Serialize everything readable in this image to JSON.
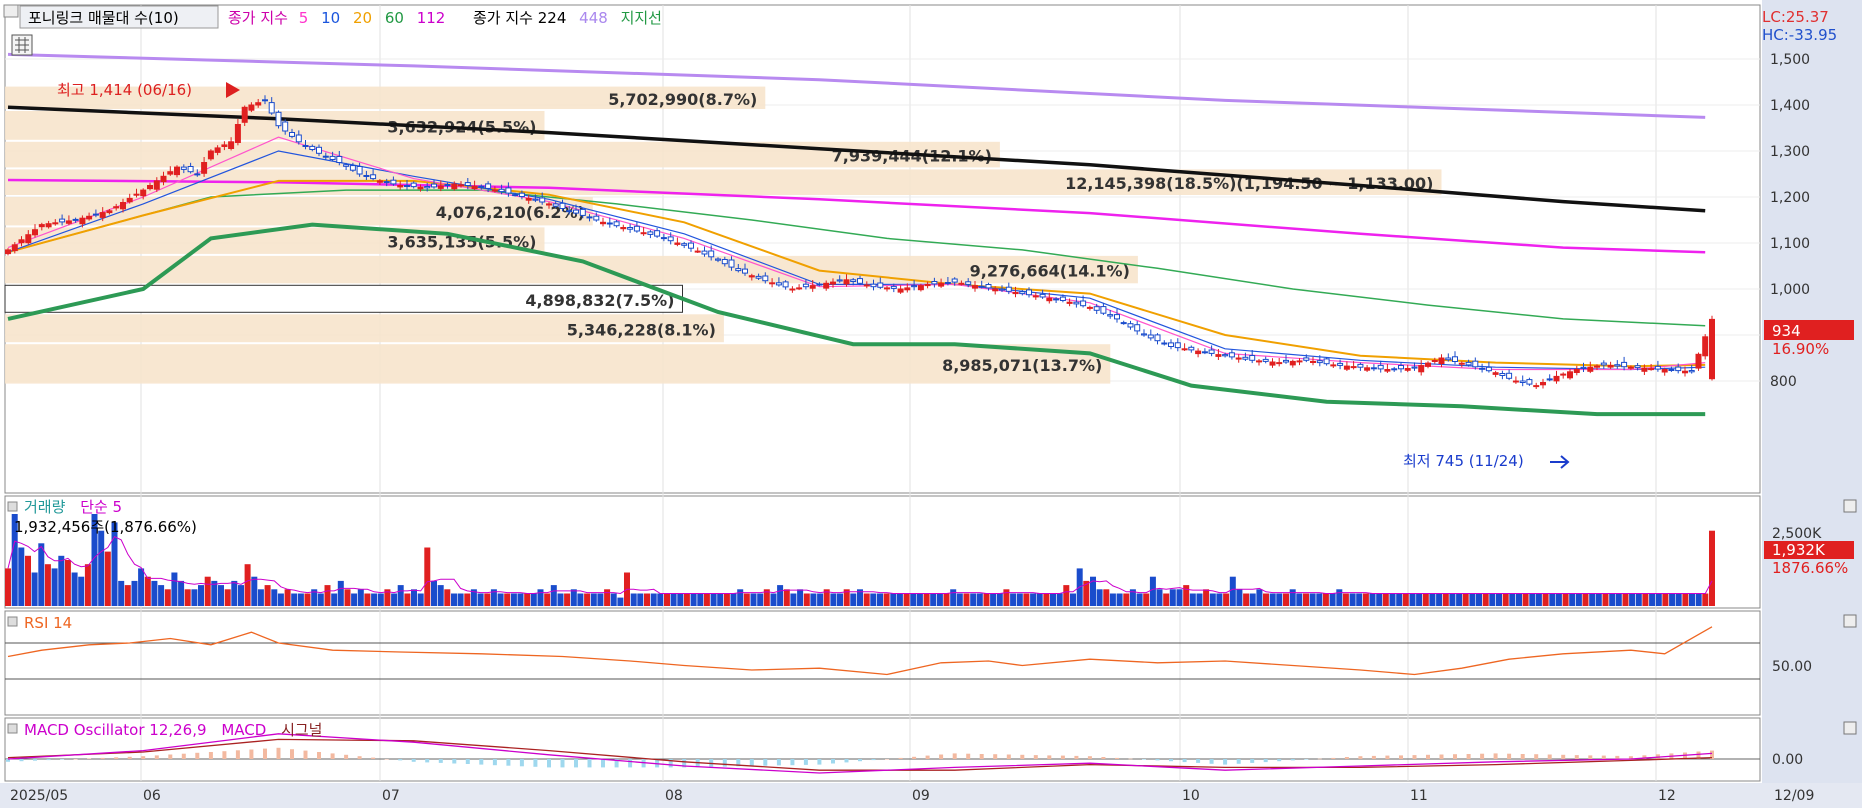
{
  "header": {
    "title_box": "포니링크 매물대 수(10)",
    "ma_label": "종가 지수",
    "ma_periods": [
      "5",
      "10",
      "20",
      "60",
      "112"
    ],
    "ma_colors": [
      "#ff33cc",
      "#1a55dd",
      "#f0a000",
      "#229944",
      "#cc00cc"
    ],
    "long_ma_label": "종가 지수 224",
    "long_ma_extra": "448",
    "long_ma_extra_color": "#aa88ee",
    "support_label": "지지선",
    "support_color": "#229944",
    "lc_label": "LC:25.37",
    "hc_label": "HC:-33.95"
  },
  "annotations": {
    "high": "최고 1,414 (06/16)",
    "low": "최저 745 (11/24)",
    "current_price": "934",
    "current_change": "16.90%"
  },
  "volume_panel": {
    "title": "거래량",
    "ma_label": "단순 5",
    "info": "1,932,456주(1,876.66%)",
    "current": "1,932K",
    "current_pct": "1876.66%",
    "tick_label": "2,500K"
  },
  "rsi_panel": {
    "title": "RSI 14",
    "tick_label": "50.00"
  },
  "macd_panel": {
    "title": "MACD Oscillator 12,26,9",
    "macd_label": "MACD",
    "signal_label": "시그널",
    "tick_label": "0.00"
  },
  "x_axis": {
    "labels": [
      "2025/05",
      "06",
      "07",
      "08",
      "09",
      "10",
      "11",
      "12"
    ],
    "end_label": "12/09"
  },
  "chart_data": {
    "type": "candlestick",
    "price_axis": {
      "min": 700,
      "max": 1500,
      "ticks": [
        "1,500",
        "1,400",
        "1,300",
        "1,200",
        "1,100",
        "1,000",
        "800"
      ]
    },
    "volume_profile": [
      {
        "price_low": 1387,
        "price_high": 1440,
        "text": "5,702,990(8.7%)"
      },
      {
        "price_low": 1320,
        "price_high": 1387,
        "text": "3,632,924(5.5%)"
      },
      {
        "price_low": 1260,
        "price_high": 1320,
        "text": "7,939,444(12.1%)"
      },
      {
        "price_low": 1200,
        "price_high": 1260,
        "text": "12,145,398(18.5%)(1,194.50 ~ 1,133.00)"
      },
      {
        "price_low": 1134,
        "price_high": 1200,
        "text": "4,076,210(6.2%)"
      },
      {
        "price_low": 1072,
        "price_high": 1134,
        "text": "3,635,135(5.5%)"
      },
      {
        "price_low": 1008,
        "price_high": 1072,
        "text": "9,276,664(14.1%)"
      },
      {
        "price_low": 945,
        "price_high": 1008,
        "text": "4,898,832(7.5%)"
      },
      {
        "price_low": 880,
        "price_high": 945,
        "text": "5,346,228(8.1%)"
      },
      {
        "price_low": 790,
        "price_high": 880,
        "text": "8,985,071(13.7%)"
      }
    ],
    "highlight_profile_index": 7,
    "close_points": [
      [
        0,
        1085
      ],
      [
        5,
        1140
      ],
      [
        10,
        1150
      ],
      [
        15,
        1170
      ],
      [
        20,
        1215
      ],
      [
        25,
        1265
      ],
      [
        28,
        1250
      ],
      [
        30,
        1300
      ],
      [
        33,
        1320
      ],
      [
        35,
        1395
      ],
      [
        38,
        1410
      ],
      [
        40,
        1355
      ],
      [
        43,
        1320
      ],
      [
        46,
        1295
      ],
      [
        49,
        1275
      ],
      [
        52,
        1250
      ],
      [
        55,
        1235
      ],
      [
        58,
        1225
      ],
      [
        62,
        1220
      ],
      [
        66,
        1228
      ],
      [
        70,
        1222
      ],
      [
        75,
        1205
      ],
      [
        80,
        1185
      ],
      [
        84,
        1165
      ],
      [
        88,
        1145
      ],
      [
        92,
        1130
      ],
      [
        96,
        1115
      ],
      [
        100,
        1095
      ],
      [
        104,
        1070
      ],
      [
        108,
        1040
      ],
      [
        112,
        1018
      ],
      [
        116,
        1000
      ],
      [
        120,
        1010
      ],
      [
        124,
        1020
      ],
      [
        128,
        1005
      ],
      [
        132,
        1000
      ],
      [
        136,
        1010
      ],
      [
        140,
        1015
      ],
      [
        144,
        1005
      ],
      [
        148,
        995
      ],
      [
        152,
        985
      ],
      [
        156,
        975
      ],
      [
        160,
        960
      ],
      [
        164,
        935
      ],
      [
        168,
        900
      ],
      [
        172,
        875
      ],
      [
        176,
        865
      ],
      [
        180,
        855
      ],
      [
        184,
        845
      ],
      [
        188,
        840
      ],
      [
        192,
        845
      ],
      [
        196,
        835
      ],
      [
        200,
        830
      ],
      [
        204,
        825
      ],
      [
        208,
        828
      ],
      [
        212,
        850
      ],
      [
        216,
        835
      ],
      [
        220,
        818
      ],
      [
        223,
        800
      ],
      [
        226,
        790
      ],
      [
        229,
        810
      ],
      [
        232,
        825
      ],
      [
        236,
        835
      ],
      [
        240,
        830
      ],
      [
        245,
        825
      ],
      [
        249,
        820
      ],
      [
        252,
        934
      ]
    ],
    "ma5_points": [
      [
        0,
        1090
      ],
      [
        20,
        1200
      ],
      [
        40,
        1330
      ],
      [
        60,
        1240
      ],
      [
        80,
        1190
      ],
      [
        100,
        1110
      ],
      [
        120,
        1005
      ],
      [
        140,
        1010
      ],
      [
        160,
        970
      ],
      [
        180,
        860
      ],
      [
        200,
        840
      ],
      [
        220,
        825
      ],
      [
        240,
        825
      ],
      [
        251,
        840
      ]
    ],
    "ma10_points": [
      [
        0,
        1080
      ],
      [
        20,
        1185
      ],
      [
        40,
        1300
      ],
      [
        60,
        1245
      ],
      [
        80,
        1195
      ],
      [
        100,
        1120
      ],
      [
        120,
        1010
      ],
      [
        140,
        1010
      ],
      [
        160,
        980
      ],
      [
        180,
        870
      ],
      [
        200,
        845
      ],
      [
        220,
        830
      ],
      [
        240,
        825
      ],
      [
        251,
        830
      ]
    ],
    "ma20_points": [
      [
        0,
        1080
      ],
      [
        20,
        1160
      ],
      [
        40,
        1235
      ],
      [
        60,
        1235
      ],
      [
        80,
        1205
      ],
      [
        100,
        1145
      ],
      [
        120,
        1040
      ],
      [
        140,
        1010
      ],
      [
        160,
        990
      ],
      [
        180,
        900
      ],
      [
        200,
        855
      ],
      [
        220,
        840
      ],
      [
        240,
        832
      ],
      [
        251,
        835
      ]
    ],
    "ma60_points": [
      [
        0,
        1080
      ],
      [
        30,
        1200
      ],
      [
        50,
        1215
      ],
      [
        70,
        1215
      ],
      [
        90,
        1185
      ],
      [
        110,
        1150
      ],
      [
        130,
        1110
      ],
      [
        150,
        1085
      ],
      [
        170,
        1045
      ],
      [
        190,
        1000
      ],
      [
        210,
        965
      ],
      [
        230,
        935
      ],
      [
        251,
        920
      ]
    ],
    "ma112_points": [
      [
        0,
        1237
      ],
      [
        40,
        1232
      ],
      [
        80,
        1220
      ],
      [
        120,
        1195
      ],
      [
        160,
        1165
      ],
      [
        200,
        1120
      ],
      [
        230,
        1090
      ],
      [
        251,
        1080
      ]
    ],
    "ma224_points": [
      [
        0,
        1395
      ],
      [
        40,
        1370
      ],
      [
        80,
        1340
      ],
      [
        120,
        1305
      ],
      [
        160,
        1270
      ],
      [
        200,
        1225
      ],
      [
        230,
        1190
      ],
      [
        251,
        1170
      ]
    ],
    "ma448_points": [
      [
        0,
        1510
      ],
      [
        60,
        1485
      ],
      [
        120,
        1455
      ],
      [
        180,
        1410
      ],
      [
        251,
        1373
      ]
    ],
    "support_points": [
      [
        0,
        935
      ],
      [
        20,
        1000
      ],
      [
        30,
        1110
      ],
      [
        45,
        1140
      ],
      [
        65,
        1120
      ],
      [
        85,
        1060
      ],
      [
        105,
        950
      ],
      [
        125,
        880
      ],
      [
        140,
        880
      ],
      [
        160,
        860
      ],
      [
        175,
        790
      ],
      [
        195,
        755
      ],
      [
        215,
        745
      ],
      [
        235,
        728
      ],
      [
        251,
        728
      ]
    ],
    "volume_series": [
      9,
      22,
      14,
      12,
      8,
      15,
      10,
      9,
      12,
      11,
      8,
      7,
      10,
      22,
      18,
      13,
      20,
      6,
      5,
      6,
      9,
      7,
      6,
      5,
      4,
      8,
      6,
      4,
      4,
      5,
      7,
      6,
      5,
      4,
      6,
      5,
      10,
      7,
      4,
      5,
      4,
      3,
      4,
      3,
      3,
      3,
      4,
      3,
      5,
      3,
      6,
      4,
      3,
      4,
      3,
      3,
      3,
      4,
      3,
      5,
      3,
      4,
      3,
      14,
      6,
      5,
      4,
      3,
      3,
      3,
      4,
      3,
      3,
      4,
      3,
      3,
      3,
      3,
      3,
      3,
      4,
      3,
      5,
      3,
      3,
      4,
      3,
      3,
      3,
      3,
      4,
      3,
      2,
      8,
      3,
      3,
      3,
      3,
      3,
      3,
      3,
      3,
      3,
      3,
      3,
      3,
      3,
      3,
      3,
      3,
      4,
      3,
      3,
      3,
      4,
      3,
      5,
      4,
      3,
      4,
      3,
      3,
      3,
      4,
      3,
      3,
      4,
      3,
      4,
      3,
      3,
      3,
      3,
      3,
      3,
      3,
      3,
      3,
      3,
      3,
      3,
      3,
      4,
      3,
      3,
      3,
      3,
      3,
      3,
      3,
      4,
      3,
      3,
      3,
      3,
      3,
      3,
      3,
      3,
      5,
      3,
      9,
      6,
      7,
      4,
      4,
      3,
      3,
      3,
      4,
      3,
      3,
      7,
      4,
      3,
      4,
      4,
      5,
      3,
      3,
      4,
      3,
      3,
      3,
      7,
      4,
      3,
      3,
      4,
      3,
      3,
      3,
      3,
      4,
      3,
      3,
      3,
      3,
      3,
      3,
      4,
      3,
      3,
      3,
      3,
      3,
      3,
      3,
      3,
      3,
      3,
      3,
      3,
      3,
      3,
      3,
      3,
      3,
      3,
      3,
      3,
      3,
      3,
      3,
      3,
      3,
      3,
      3,
      3,
      3,
      3,
      3,
      3,
      3,
      3,
      3,
      3,
      3,
      3,
      3,
      3,
      3,
      3,
      3,
      3,
      3,
      3,
      3,
      3,
      3,
      3,
      3,
      3,
      3,
      3,
      3,
      18
    ],
    "rsi_points": [
      [
        0,
        55
      ],
      [
        5,
        62
      ],
      [
        12,
        68
      ],
      [
        18,
        70
      ],
      [
        24,
        75
      ],
      [
        30,
        68
      ],
      [
        36,
        82
      ],
      [
        40,
        70
      ],
      [
        48,
        62
      ],
      [
        58,
        60
      ],
      [
        70,
        58
      ],
      [
        82,
        55
      ],
      [
        92,
        50
      ],
      [
        100,
        45
      ],
      [
        110,
        40
      ],
      [
        120,
        42
      ],
      [
        130,
        35
      ],
      [
        138,
        48
      ],
      [
        145,
        50
      ],
      [
        150,
        45
      ],
      [
        160,
        52
      ],
      [
        170,
        48
      ],
      [
        180,
        50
      ],
      [
        190,
        45
      ],
      [
        200,
        40
      ],
      [
        208,
        35
      ],
      [
        215,
        42
      ],
      [
        222,
        52
      ],
      [
        230,
        58
      ],
      [
        240,
        62
      ],
      [
        245,
        58
      ],
      [
        252,
        88
      ]
    ],
    "rsi_range": [
      0,
      100
    ],
    "macd_points": [
      [
        0,
        0
      ],
      [
        20,
        6
      ],
      [
        40,
        18
      ],
      [
        60,
        12
      ],
      [
        80,
        3
      ],
      [
        100,
        -5
      ],
      [
        120,
        -10
      ],
      [
        140,
        -6
      ],
      [
        160,
        -3
      ],
      [
        180,
        -8
      ],
      [
        200,
        -5
      ],
      [
        220,
        -2
      ],
      [
        240,
        0
      ],
      [
        252,
        4
      ]
    ],
    "signal_points": [
      [
        0,
        1
      ],
      [
        20,
        5
      ],
      [
        40,
        14
      ],
      [
        60,
        13
      ],
      [
        80,
        6
      ],
      [
        100,
        -2
      ],
      [
        120,
        -8
      ],
      [
        140,
        -8
      ],
      [
        160,
        -4
      ],
      [
        180,
        -6
      ],
      [
        200,
        -6
      ],
      [
        220,
        -4
      ],
      [
        240,
        -1
      ],
      [
        252,
        1
      ]
    ]
  }
}
